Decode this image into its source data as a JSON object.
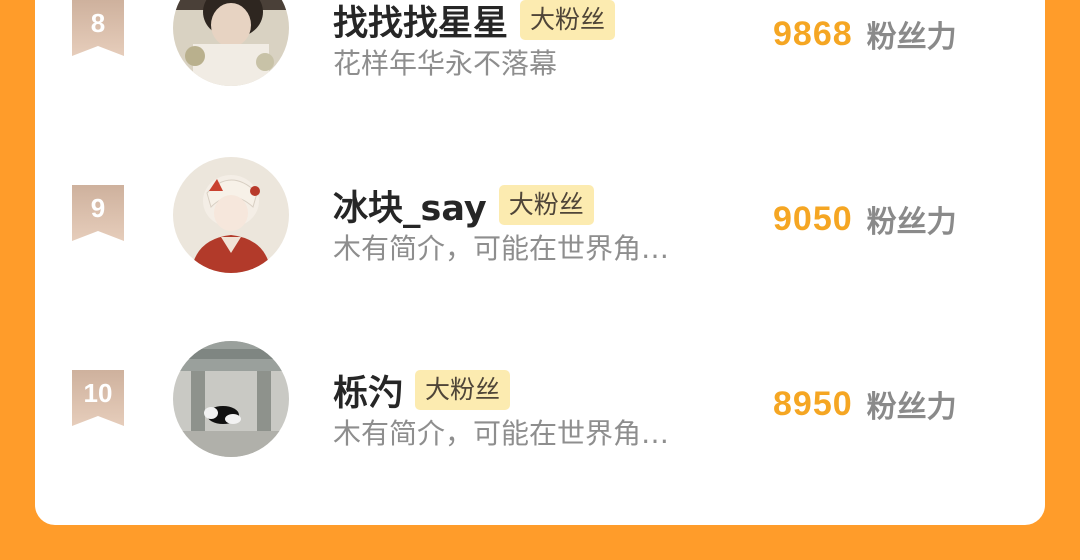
{
  "ranking": {
    "entries": [
      {
        "rank": "8",
        "name": "找找找星星",
        "badge": "大粉丝",
        "bio": "花样年华永不落幕",
        "score": "9868",
        "score_unit": "粉丝力"
      },
      {
        "rank": "9",
        "name": "冰块_say",
        "badge": "大粉丝",
        "bio": "木有简介，可能在世界角…",
        "score": "9050",
        "score_unit": "粉丝力"
      },
      {
        "rank": "10",
        "name": "栎汋",
        "badge": "大粉丝",
        "bio": "木有简介，可能在世界角…",
        "score": "8950",
        "score_unit": "粉丝力"
      }
    ]
  },
  "colors": {
    "background": "#ff9c2a",
    "score": "#f5a623",
    "badge_bg": "#fcebb0",
    "rank_badge": "#d9b6a0"
  }
}
